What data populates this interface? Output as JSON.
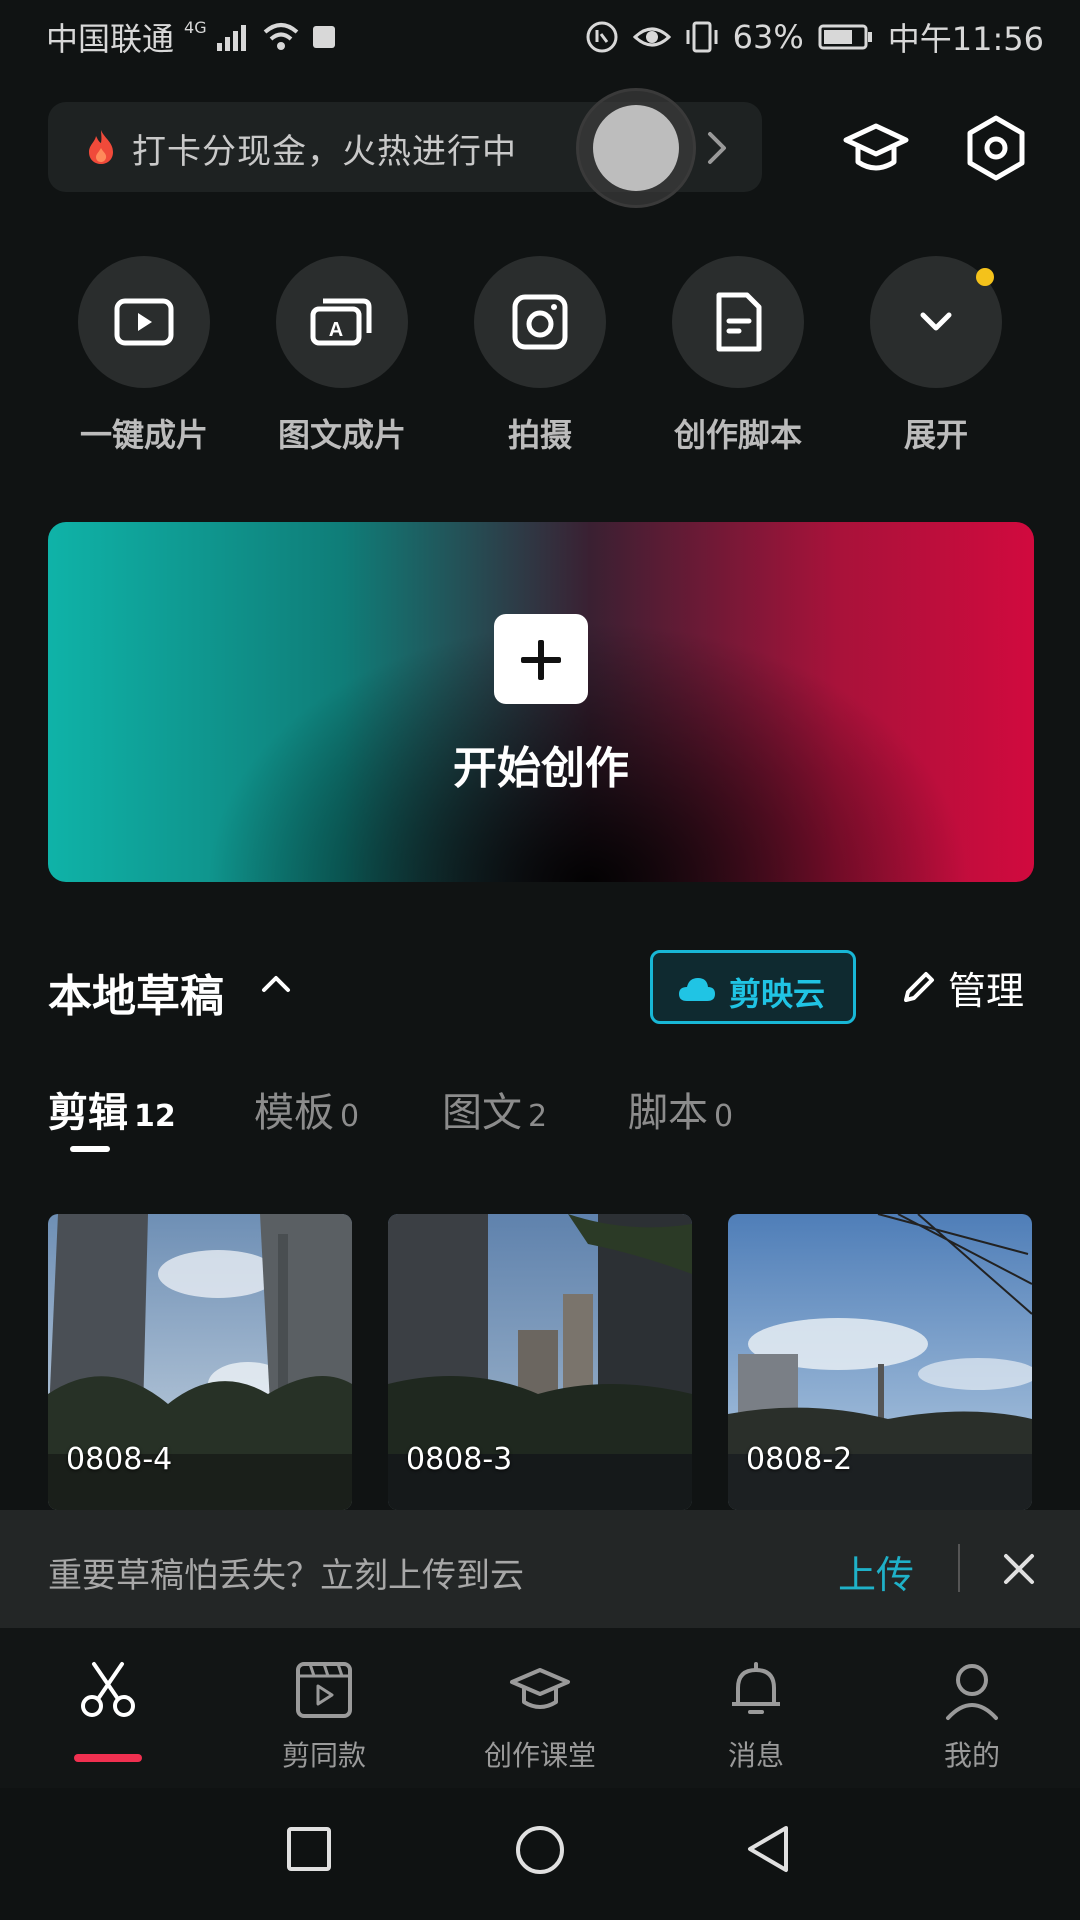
{
  "status_bar": {
    "carrier": "中国联通",
    "network": "4G",
    "battery": "63%",
    "time": "中午11:56"
  },
  "promo": {
    "text": "打卡分现金，火热进行中"
  },
  "quick_actions": [
    {
      "label": "一键成片",
      "icon": "play-box-icon"
    },
    {
      "label": "图文成片",
      "icon": "text-to-video-icon"
    },
    {
      "label": "拍摄",
      "icon": "camera-icon"
    },
    {
      "label": "创作脚本",
      "icon": "script-doc-icon"
    },
    {
      "label": "展开",
      "icon": "chevron-down-icon"
    }
  ],
  "hero": {
    "title": "开始创作"
  },
  "drafts": {
    "title": "本地草稿",
    "cloud_label": "剪映云",
    "manage_label": "管理",
    "tabs": [
      {
        "label": "剪辑",
        "count": "12",
        "active": true
      },
      {
        "label": "模板",
        "count": "0",
        "active": false
      },
      {
        "label": "图文",
        "count": "2",
        "active": false
      },
      {
        "label": "脚本",
        "count": "0",
        "active": false
      }
    ],
    "items": [
      {
        "name": "0808-4"
      },
      {
        "name": "0808-3"
      },
      {
        "name": "0808-2"
      }
    ]
  },
  "upload_bar": {
    "message": "重要草稿怕丢失？立刻上传到云",
    "action": "上传"
  },
  "bottom_nav": [
    {
      "label": "",
      "icon": "scissors-icon",
      "active": true
    },
    {
      "label": "剪同款",
      "icon": "clapper-icon",
      "active": false
    },
    {
      "label": "创作课堂",
      "icon": "graduation-cap-icon",
      "active": false
    },
    {
      "label": "消息",
      "icon": "bell-icon",
      "active": false
    },
    {
      "label": "我的",
      "icon": "user-icon",
      "active": false
    }
  ],
  "colors": {
    "accent_cyan": "#20c4e4",
    "accent_red": "#f03050",
    "badge_yellow": "#f4c21b",
    "background": "#101313"
  }
}
